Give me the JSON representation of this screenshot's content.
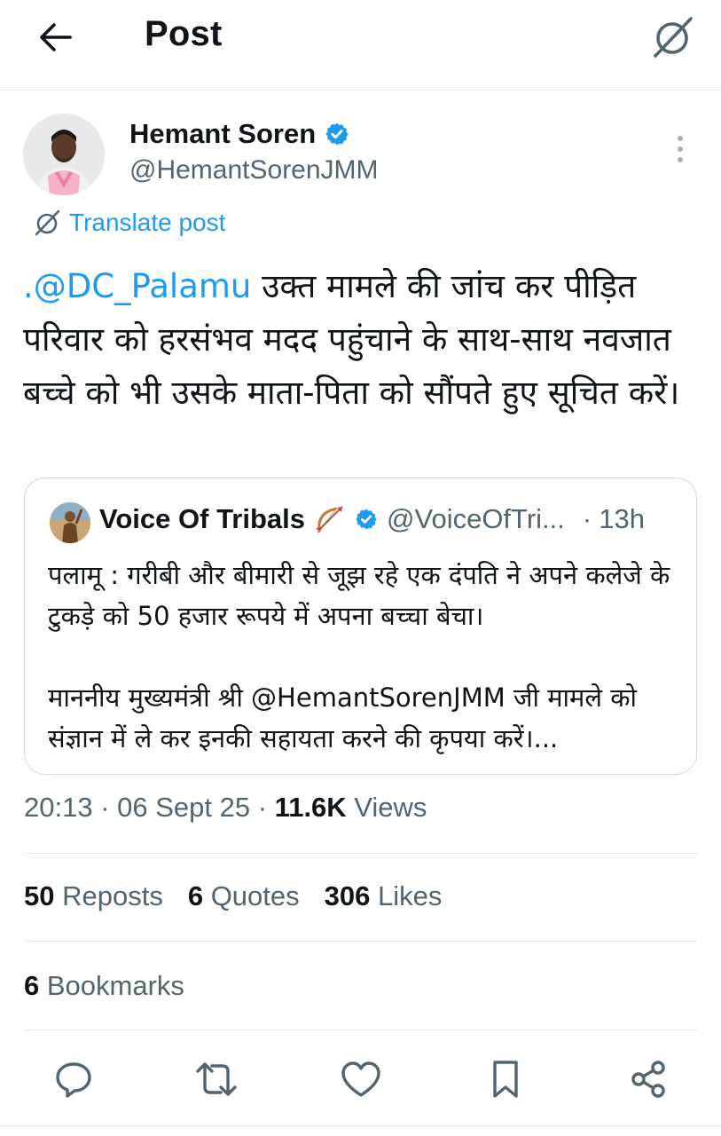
{
  "header": {
    "title": "Post",
    "back_icon": "arrow-left-icon",
    "translate_icon": "translate-icon"
  },
  "author": {
    "name": "Hemant Soren",
    "handle": "@HemantSorenJMM",
    "verified": true
  },
  "translate_label": "Translate post",
  "post": {
    "mention": ".@DC_Palamu",
    "text": " उक्त मामले की जांच कर पीड़ित परिवार को हरसंभव मदद पहुंचाने के साथ-साथ नवजात बच्चे को भी उसके माता-पिता को सौंपते हुए सूचित करें।"
  },
  "quote": {
    "name": "Voice Of Tribals",
    "handle": "@VoiceOfTri...",
    "dot": "·",
    "time": "13h",
    "paragraphs": [
      "पलामू : गरीबी और बीमारी से जूझ रहे एक दंपति ने अपने कलेजे के टुकड़े को 50 हजार रूपये में अपना बच्चा बेचा।",
      "माननीय मुख्यमंत्री श्री @HemantSorenJMM जी मामले को संज्ञान में ले कर इनकी सहायता करने की कृपया करें।..."
    ]
  },
  "meta": {
    "time": "20:13",
    "sep1": " · ",
    "date": "06 Sept 25",
    "sep2": " · ",
    "views_count": "11.6K",
    "views_label": " Views"
  },
  "stats": {
    "reposts_count": "50",
    "reposts_label": " Reposts",
    "quotes_count": "6",
    "quotes_label": " Quotes",
    "likes_count": "306",
    "likes_label": " Likes"
  },
  "bookmarks": {
    "count": "6",
    "label": " Bookmarks"
  },
  "colors": {
    "accent": "#1d9bf0",
    "secondary_text": "#536471",
    "primary_text": "#0f1419",
    "divider": "#e7e9ea"
  },
  "actions": [
    "reply-icon",
    "repost-icon",
    "like-icon",
    "bookmark-icon",
    "share-icon"
  ]
}
